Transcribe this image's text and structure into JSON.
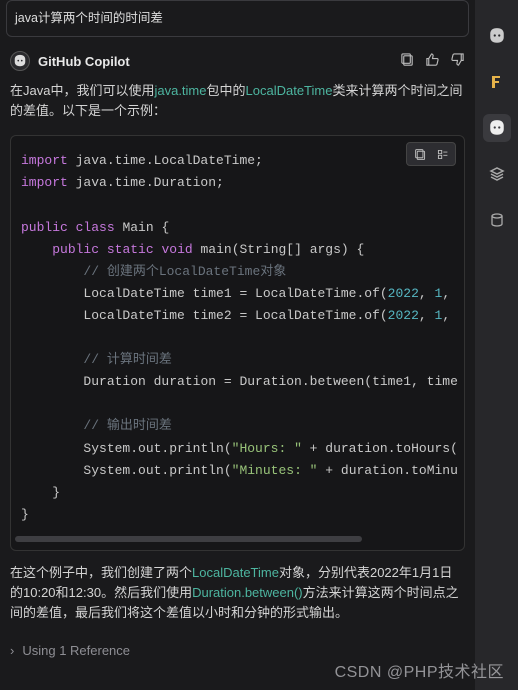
{
  "query": "java计算两个时间的时间差",
  "assistant": {
    "name": "GitHub Copilot",
    "intro_prefix": "在Java中，我们可以使用",
    "pkg": "java.time",
    "intro_mid": "包中的",
    "cls": "LocalDateTime",
    "intro_suffix": "类来计算两个时间之间的差值。以下是一个示例：",
    "outro_prefix": "在这个例子中，我们创建了两个",
    "outro_cls": "LocalDateTime",
    "outro_mid1": "对象，分别代表2022年1月1日的10:20和12:30。然后我们使用",
    "outro_fn": "Duration.between()",
    "outro_suffix": "方法来计算这两个时间点之间的差值，最后我们将这个差值以小时和分钟的形式输出。"
  },
  "code": {
    "kw_import": "import",
    "pkg_ldt": " java.time.LocalDateTime;",
    "pkg_dur": " java.time.Duration;",
    "kw_public": "public",
    "kw_class": "class",
    "main_class": " Main {",
    "kw_static": "static",
    "kw_void": "void",
    "main_sig": " main(String[] args) {",
    "cmt1": "// 创建两个LocalDateTime对象",
    "l1a": "LocalDateTime time1 = LocalDateTime.of(",
    "l1b": ", ",
    "l1c": ",",
    "num2022": "2022",
    "num1": "1",
    "l2a": "LocalDateTime time2 = LocalDateTime.of(",
    "cmt2": "// 计算时间差",
    "l3": "Duration duration = Duration.between(time1, time",
    "cmt3": "// 输出时间差",
    "l4a": "System.out.println(",
    "str_hours": "\"Hours: \"",
    "l4b": " + duration.toHours(",
    "str_min": "\"Minutes: \"",
    "l5b": " + duration.toMinu",
    "close_inner": "    }",
    "close_outer": "}"
  },
  "references": {
    "label": "Using 1 Reference"
  },
  "watermark": "CSDN @PHP技术社区"
}
